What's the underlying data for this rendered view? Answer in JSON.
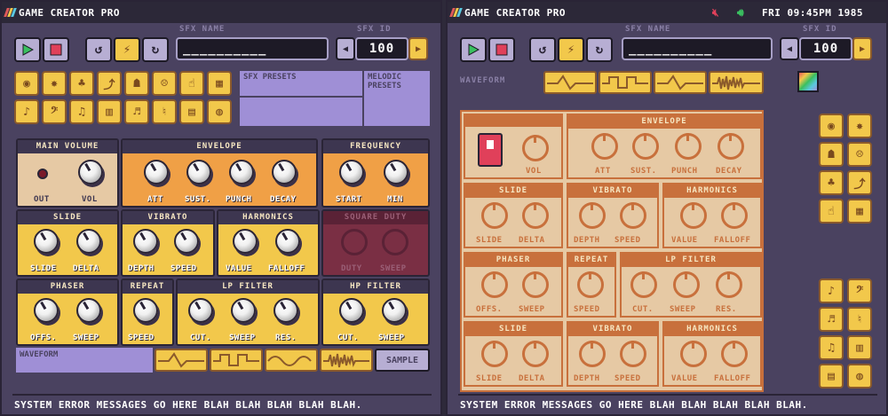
{
  "left": {
    "title": "GAME CREATOR PRO",
    "sfx_name_label": "SFX NAME",
    "sfx_name_value": "__________",
    "sfx_id_label": "SFX ID",
    "sfx_id_value": "100",
    "sfx_presets_label": "SFX PRESETS",
    "melodic_presets_label": "MELODIC PRESETS",
    "panels": {
      "main_volume": "MAIN VOLUME",
      "envelope": "ENVELOPE",
      "frequency": "FREQUENCY",
      "slide": "SLIDE",
      "vibrato": "VIBRATO",
      "harmonics": "HARMONICS",
      "square_duty": "SQUARE DUTY",
      "phaser": "PHASER",
      "repeat": "REPEAT",
      "lp_filter": "LP FILTER",
      "hp_filter": "HP FILTER"
    },
    "labels": {
      "out": "OUT",
      "vol": "VOL",
      "att": "ATT",
      "sust": "SUST.",
      "punch": "PUNCH",
      "decay": "DECAY",
      "start": "START",
      "min": "MIN",
      "slide": "SLIDE",
      "delta": "DELTA",
      "depth": "DEPTH",
      "speed": "SPEED",
      "value": "VALUE",
      "falloff": "FALLOFF",
      "duty": "DUTY",
      "sweep": "SWEEP",
      "offs": "OFFS.",
      "cut": "CUT.",
      "res": "RES."
    },
    "waveform_label": "WAVEFORM",
    "sample_label": "SAMPLE",
    "status": "SYSTEM ERROR MESSAGES GO HERE BLAH BLAH BLAH BLAH BLAH."
  },
  "right": {
    "title": "GAME CREATOR PRO",
    "clock": "FRI 09:45PM 1985",
    "sfx_name_label": "SFX NAME",
    "sfx_name_value": "__________",
    "sfx_id_label": "SFX ID",
    "sfx_id_value": "100",
    "waveform_label": "WAVEFORM",
    "panels": {
      "envelope": "ENVELOPE",
      "slide": "SLIDE",
      "vibrato": "VIBRATO",
      "harmonics": "HARMONICS",
      "phaser": "PHASER",
      "repeat": "REPEAT",
      "lp_filter": "LP FILTER"
    },
    "labels": {
      "vol": "VOL",
      "att": "ATT",
      "sust": "SUST.",
      "punch": "PUNCH",
      "decay": "DECAY",
      "slide": "SLIDE",
      "delta": "DELTA",
      "depth": "DEPTH",
      "speed": "SPEED",
      "value": "VALUE",
      "falloff": "FALLOFF",
      "offs": "OFFS.",
      "sweep": "SWEEP",
      "cut": "CUT.",
      "res": "RES."
    },
    "status": "SYSTEM ERROR MESSAGES GO HERE BLAH BLAH BLAH BLAH BLAH."
  },
  "colors": {
    "yellow": "#f2c84b",
    "orange": "#f0a046",
    "purple": "#9f8fd6",
    "tan": "#e6c9a4",
    "rust": "#c8703c",
    "maroon": "#7a2f44"
  },
  "icons": {
    "play": "play-icon",
    "stop": "stop-icon",
    "undo": "undo-icon",
    "random": "lightning-icon",
    "redo": "redo-icon",
    "next": "arrow-right-icon",
    "prev": "arrow-left-icon",
    "mute": "mute-icon",
    "volume": "volume-icon"
  }
}
